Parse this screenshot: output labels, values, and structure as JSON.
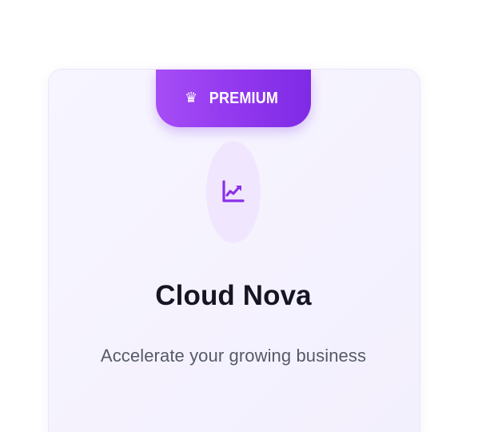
{
  "card": {
    "badge": {
      "icon": "crown-icon",
      "label": "PREMIUM",
      "colors": {
        "start": "#a64df6",
        "end": "#7f2ae6",
        "text": "#ffffff"
      }
    },
    "feature_icon": "chart-trending-up-icon",
    "title": "Cloud Nova",
    "subtitle": "Accelerate your growing business",
    "colors": {
      "card_background": "#f6f3ff",
      "icon_background": "#f0e7ff",
      "accent": "#8c2fe8",
      "title": "#151523",
      "subtitle": "#555a67"
    }
  }
}
